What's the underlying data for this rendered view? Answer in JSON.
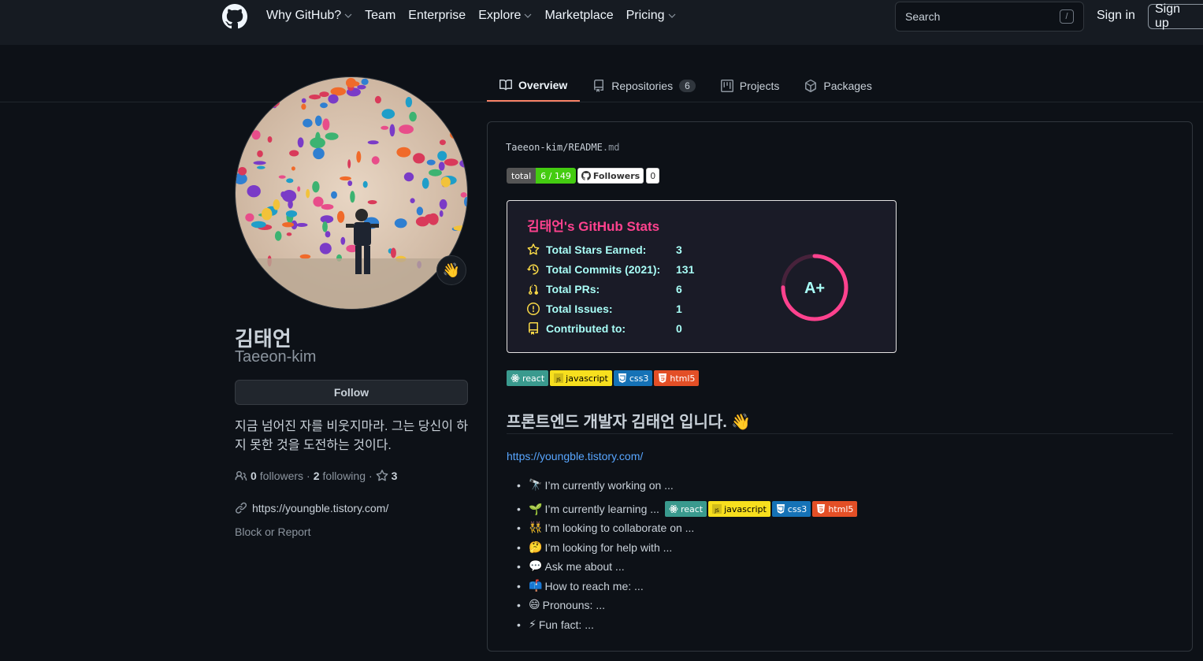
{
  "header": {
    "nav": [
      {
        "label": "Why GitHub?",
        "has_menu": true
      },
      {
        "label": "Team",
        "has_menu": false
      },
      {
        "label": "Enterprise",
        "has_menu": false
      },
      {
        "label": "Explore",
        "has_menu": true
      },
      {
        "label": "Marketplace",
        "has_menu": false
      },
      {
        "label": "Pricing",
        "has_menu": true
      }
    ],
    "search_placeholder": "Search",
    "search_shortcut": "/",
    "sign_in": "Sign in",
    "sign_up": "Sign up"
  },
  "tabs": [
    {
      "label": "Overview",
      "active": true,
      "icon": "book-icon"
    },
    {
      "label": "Repositories",
      "count": "6",
      "icon": "repo-icon"
    },
    {
      "label": "Projects",
      "icon": "project-icon"
    },
    {
      "label": "Packages",
      "icon": "package-icon"
    }
  ],
  "profile": {
    "status_emoji": "👋",
    "name": "김태언",
    "login": "Taeeon-kim",
    "follow_label": "Follow",
    "bio": "지금 넘어진 자를 비웃지마라. 그는 당신이 하지 못한 것을 도전하는 것이다.",
    "followers_count": "0",
    "followers_label": "followers",
    "separator": "·",
    "following_count": "2",
    "following_label": "following",
    "stars_count": "3",
    "website": "https://youngble.tistory.com/",
    "block_report": "Block or Report"
  },
  "readme": {
    "owner": "Taeeon-kim",
    "slash": "/",
    "file_name": "README",
    "file_ext": ".md",
    "badge_total_label": "total",
    "badge_total_value": "6 / 149",
    "badge_followers_label": "Followers",
    "badge_followers_count": "0",
    "stats": {
      "title": "김태언's GitHub Stats",
      "rows": [
        {
          "label": "Total Stars Earned:",
          "value": "3",
          "icon": "star-icon"
        },
        {
          "label": "Total Commits (2021):",
          "value": "131",
          "icon": "history-icon"
        },
        {
          "label": "Total PRs:",
          "value": "6",
          "icon": "pull-request-icon"
        },
        {
          "label": "Total Issues:",
          "value": "1",
          "icon": "issue-icon"
        },
        {
          "label": "Contributed to:",
          "value": "0",
          "icon": "repo-icon"
        }
      ],
      "grade": "A+",
      "grade_progress": 0.75,
      "colors": {
        "bg": "#1a1b27",
        "title": "#fe428e",
        "text": "#a9fef7",
        "icon": "#f8d847",
        "ring": "#fe428e"
      }
    },
    "lang_badges": [
      "react",
      "javascript",
      "css3",
      "html5"
    ],
    "heading": "프론트엔드 개발자 김태언 입니다.",
    "heading_emoji": "👋",
    "link": "https://youngble.tistory.com/",
    "bullets": [
      {
        "emoji": "🔭",
        "text": "I’m currently working on ..."
      },
      {
        "emoji": "🌱",
        "text": "I’m currently learning ...",
        "badges": true
      },
      {
        "emoji": "👯",
        "text": "I’m looking to collaborate on ..."
      },
      {
        "emoji": "🤔",
        "text": "I’m looking for help with ..."
      },
      {
        "emoji": "💬",
        "text": "Ask me about ..."
      },
      {
        "emoji": "📫",
        "text": "How to reach me: ..."
      },
      {
        "emoji": "😄",
        "text": "Pronouns: ..."
      },
      {
        "emoji": "⚡",
        "text": "Fun fact: ..."
      }
    ]
  }
}
